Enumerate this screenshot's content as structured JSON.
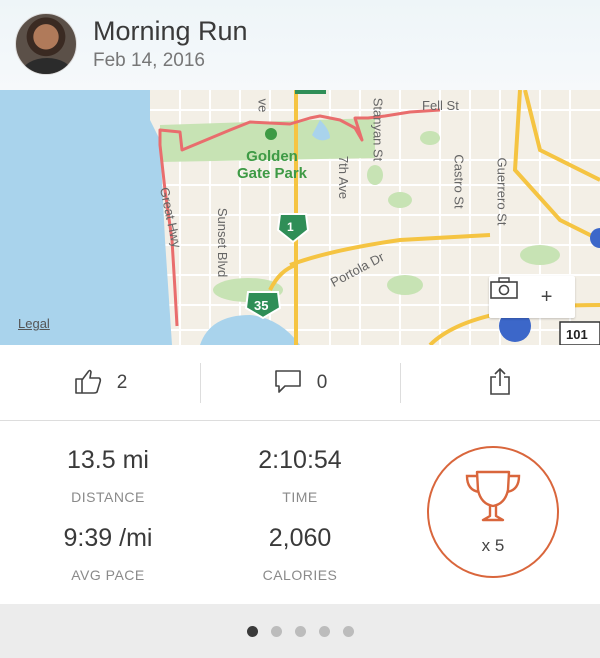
{
  "activity": {
    "title": "Morning Run",
    "date": "Feb 14, 2016"
  },
  "map": {
    "park_label": "Golden Gate Park",
    "labels": [
      "ve",
      "Fell St",
      "Stanyan St",
      "7th Ave",
      "Castro St",
      "Guerrero St",
      "Great Hwy",
      "Sunset Blvd",
      "Portola Dr"
    ],
    "shields": [
      "1",
      "35",
      "101"
    ],
    "legal": "Legal",
    "camera_plus": "+",
    "colors": {
      "water": "#a9d3ec",
      "park": "#c7e3b4",
      "route": "#e96d6d",
      "highway": "#f5c442",
      "shield": "#2f8e57"
    }
  },
  "actions": {
    "likes": "2",
    "comments": "0"
  },
  "stats": {
    "distance": {
      "value": "13.5 mi",
      "label": "DISTANCE"
    },
    "time": {
      "value": "2:10:54",
      "label": "TIME"
    },
    "pace": {
      "value": "9:39 /mi",
      "label": "AVG PACE"
    },
    "calories": {
      "value": "2,060",
      "label": "CALORIES"
    },
    "achievements": "x 5"
  },
  "pager": {
    "total": 5,
    "active": 1
  }
}
